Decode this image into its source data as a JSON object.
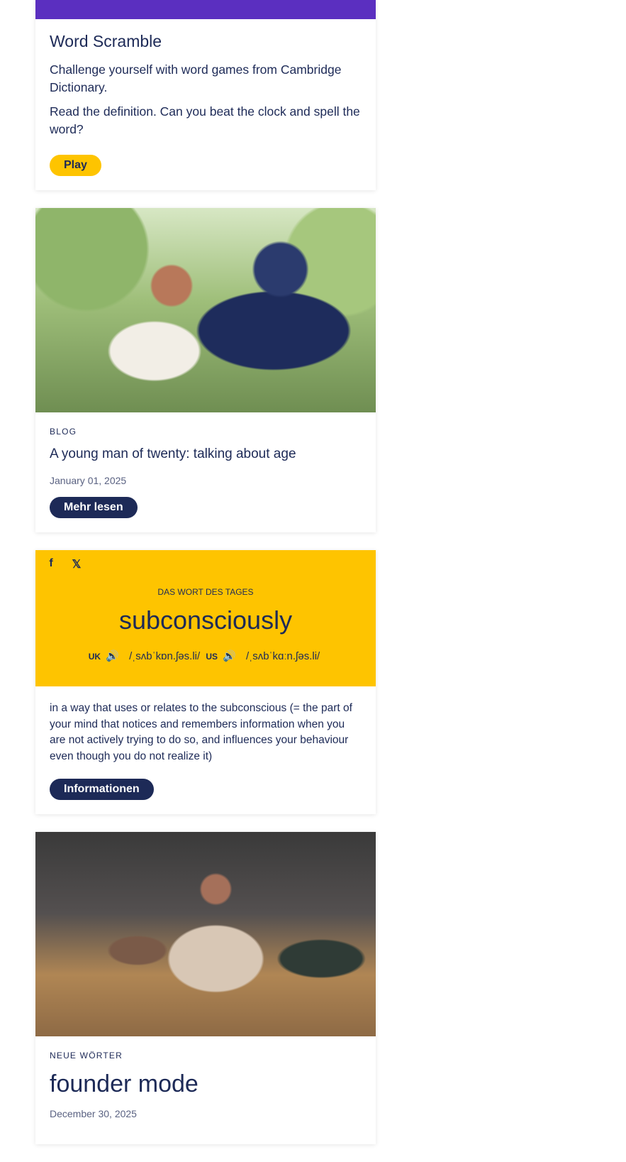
{
  "word_game": {
    "title": "Word Scramble",
    "text1": "Challenge yourself with word games from Cambridge Dictionary.",
    "text2": "Read the definition. Can you beat the clock and spell the word?",
    "button": "Play"
  },
  "blog": {
    "kicker": "BLOG",
    "title": "A young man of twenty: talking about age",
    "date": "January 01, 2025",
    "button": "Mehr lesen"
  },
  "wotd": {
    "share_facebook": "f",
    "share_x": "𝕏",
    "label": "DAS WORT DES TAGES",
    "word": "subconsciously",
    "uk_label": "UK",
    "uk_ipa": "/ˌsʌbˈkɒn.ʃəs.li/",
    "us_label": "US",
    "us_ipa": "/ˌsʌbˈkɑːn.ʃəs.li/",
    "speaker": "🔊",
    "definition": "in a way that uses or relates to the subconscious (= the part of your mind that notices and remembers information when you are not actively trying to do so, and influences your behaviour even though you do not realize it)",
    "button": "Informationen"
  },
  "new_words": {
    "kicker": "NEUE WÖRTER",
    "title": "founder mode",
    "date": "December 30, 2025"
  },
  "colors": {
    "navy": "#1d2a57",
    "yellow": "#fec400",
    "purple": "#5b2fc0"
  }
}
